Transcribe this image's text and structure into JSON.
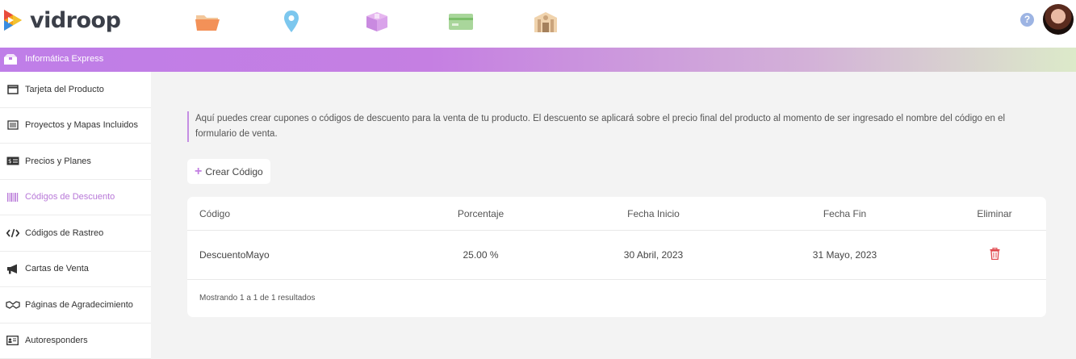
{
  "brand": {
    "name": "vidroop"
  },
  "top_nav": [
    "folder-icon",
    "location-pin-icon",
    "box-icon",
    "credit-card-icon",
    "store-icon"
  ],
  "help": {
    "label": "?"
  },
  "banner": {
    "title": "Informática Express"
  },
  "sidebar": {
    "items": [
      {
        "label": "Tarjeta del Producto",
        "icon": "window-icon"
      },
      {
        "label": "Proyectos y Mapas Incluidos",
        "icon": "list-icon"
      },
      {
        "label": "Precios y Planes",
        "icon": "price-tag-icon"
      },
      {
        "label": "Códigos de Descuento",
        "icon": "barcode-icon",
        "active": true
      },
      {
        "label": "Códigos de Rastreo",
        "icon": "code-icon"
      },
      {
        "label": "Cartas de Venta",
        "icon": "megaphone-icon"
      },
      {
        "label": "Páginas de Agradecimiento",
        "icon": "handshake-icon"
      },
      {
        "label": "Autoresponders",
        "icon": "contact-card-icon"
      }
    ]
  },
  "main": {
    "info_text": "Aquí puedes crear cupones o códigos de descuento para la venta de tu producto. El descuento se aplicará sobre el precio final del producto al momento de ser ingresado el nombre del código en el formulario de venta.",
    "create_button": {
      "plus": "+",
      "label": "Crear Código"
    },
    "table": {
      "headers": [
        "Código",
        "Porcentaje",
        "Fecha Inicio",
        "Fecha Fin",
        "Eliminar"
      ],
      "rows": [
        {
          "code": "DescuentoMayo",
          "percent": "25.00 %",
          "start": "30 Abril, 2023",
          "end": "31 Mayo, 2023"
        }
      ],
      "footer": "Mostrando 1 a 1 de 1 resultados"
    }
  },
  "colors": {
    "accent": "#c27ee2",
    "danger": "#e0474c"
  }
}
